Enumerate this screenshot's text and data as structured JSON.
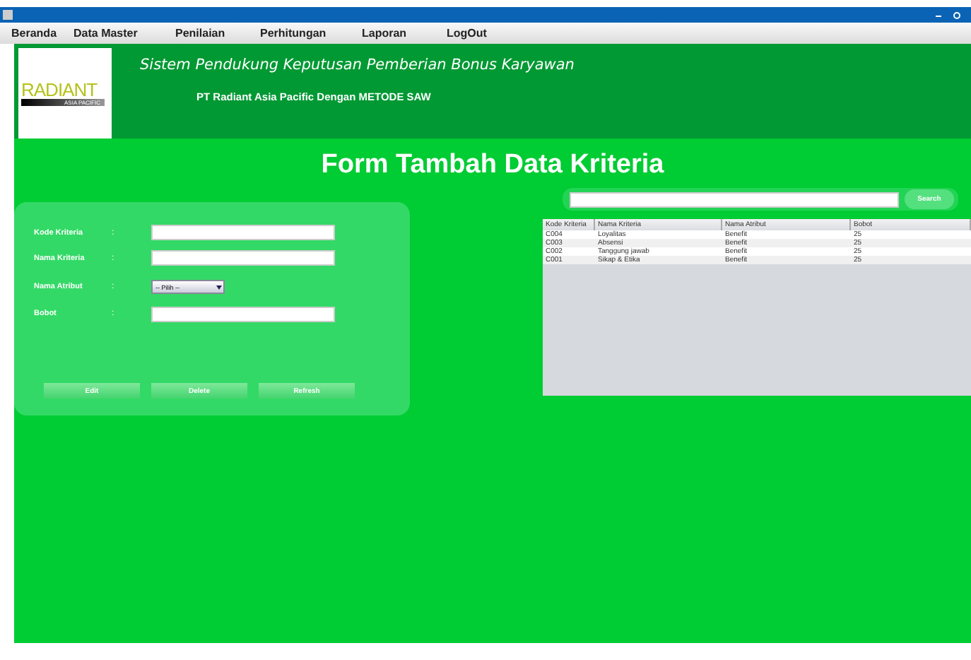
{
  "menu": [
    "Beranda",
    "Data Master",
    "Penilaian",
    "Perhitungan",
    "Laporan",
    "LogOut"
  ],
  "header": {
    "logo_text": "RADIANT",
    "logo_sub": "ASIA PACIFIC",
    "title": "Sistem Pendukung Keputusan Pemberian Bonus Karyawan",
    "subtitle": "PT Radiant Asia Pacific Dengan METODE SAW"
  },
  "page_title": "Form Tambah Data Kriteria",
  "form": {
    "fields": [
      {
        "label": "Kode Kriteria",
        "kind": "text"
      },
      {
        "label": "Nama Kriteria",
        "kind": "text"
      },
      {
        "label": "Nama Atribut",
        "kind": "select",
        "value": "-- Pilih --"
      },
      {
        "label": "Bobot",
        "kind": "text"
      }
    ],
    "separator": ":",
    "buttons": [
      "Edit",
      "Delete",
      "Refresh"
    ]
  },
  "search": {
    "button": "Search"
  },
  "table": {
    "columns": [
      "Kode Kriteria",
      "Nama Kriteria",
      "Nama Atribut",
      "Bobot"
    ],
    "rows": [
      [
        "C004",
        "Loyalitas",
        "Benefit",
        "25"
      ],
      [
        "C003",
        "Absensi",
        "Benefit",
        "25"
      ],
      [
        "C002",
        "Tanggung jawab",
        "Benefit",
        "25"
      ],
      [
        "C001",
        "Sikap & Etika",
        "Benefit",
        "25"
      ]
    ]
  }
}
